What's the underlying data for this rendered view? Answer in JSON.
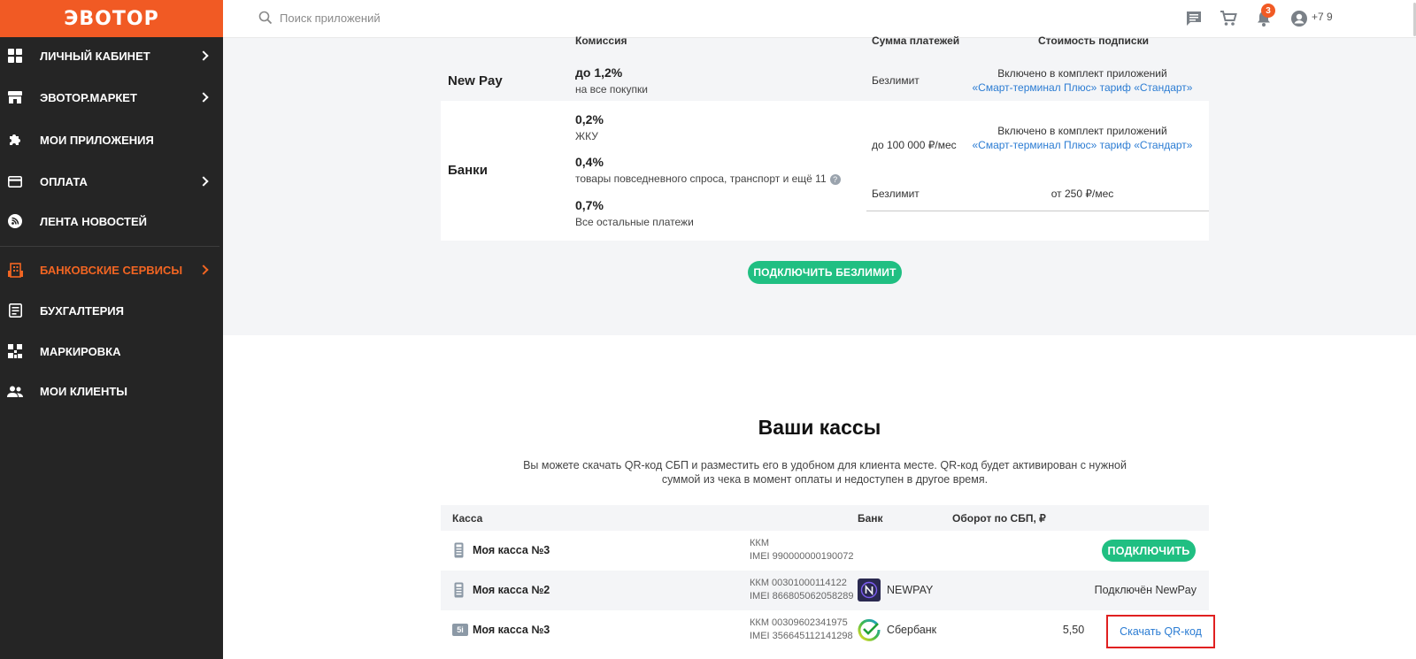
{
  "brand": {
    "logo_text": "ЭВОТОР",
    "accent_color": "#f15a24",
    "active_color": "#f26522",
    "button_color": "#20bf82",
    "link_color": "#2b7cd3"
  },
  "sidebar": {
    "items": [
      {
        "label": "ЛИЧНЫЙ КАБИНЕТ",
        "icon": "dashboard-icon",
        "has_chevron": true
      },
      {
        "label": "ЭВОТОР.МАРКЕТ",
        "icon": "store-icon",
        "has_chevron": true
      },
      {
        "label": "МОИ ПРИЛОЖЕНИЯ",
        "icon": "puzzle-icon",
        "has_chevron": false
      },
      {
        "label": "ОПЛАТА",
        "icon": "credit-card-icon",
        "has_chevron": true
      },
      {
        "label": "ЛЕНТА НОВОСТЕЙ",
        "icon": "rss-icon",
        "has_chevron": false
      },
      {
        "label": "БАНКОВСКИЕ СЕРВИСЫ",
        "icon": "bank-building-icon",
        "has_chevron": true,
        "active": true
      },
      {
        "label": "БУХГАЛТЕРИЯ",
        "icon": "ledger-icon",
        "has_chevron": false
      },
      {
        "label": "МАРКИРОВКА",
        "icon": "qr-mark-icon",
        "has_chevron": false
      },
      {
        "label": "МОИ КЛИЕНТЫ",
        "icon": "clients-icon",
        "has_chevron": false
      }
    ]
  },
  "topbar": {
    "search_placeholder": "Поиск приложений",
    "notification_count": "3",
    "phone": "+7 9"
  },
  "tariffs": {
    "headers": {
      "commission": "Комиссия",
      "payments_sum": "Сумма платежей",
      "subscription_cost": "Стоимость подписки"
    },
    "newpay": {
      "name": "New Pay",
      "rate": "до 1,2%",
      "rate_note": "на все покупки",
      "sum": "Безлимит",
      "cost_line1": "Включено в комплект приложений",
      "cost_line2": "«Смарт-терминал Плюс» тариф «Стандарт»"
    },
    "banks": {
      "name": "Банки",
      "rates": [
        {
          "value": "0,2%",
          "note": "ЖКУ"
        },
        {
          "value": "0,4%",
          "note": "товары повседневного спроса, транспорт и ещё 11"
        },
        {
          "value": "0,7%",
          "note": "Все остальные платежи"
        }
      ],
      "plan1_sum": "до 100 000 ₽/мес",
      "plan1_cost_line1": "Включено в комплект приложений",
      "plan1_cost_line2": "«Смарт-терминал Плюс» тариф «Стандарт»",
      "plan2_sum": "Безлимит",
      "plan2_cost": "от 250 ₽/мес"
    },
    "connect_button": "ПОДКЛЮЧИТЬ БЕЗЛИМИТ"
  },
  "kassas": {
    "title": "Ваши кассы",
    "description": "Вы можете скачать QR-код СБП и разместить его в удобном для клиента месте. QR-код будет активирован с нужной суммой из чека в момент оплаты и недоступен в другое время.",
    "columns": {
      "kassa": "Касса",
      "bank": "Банк",
      "turnover": "Оборот по СБП, ₽"
    },
    "rows": [
      {
        "name": "Моя касса №3",
        "kkm": "ККМ",
        "imei": "IMEI 990000000190072",
        "bank": "",
        "turnover": "",
        "action": "ПОДКЛЮЧИТЬ",
        "device": "phone-device-icon"
      },
      {
        "name": "Моя касса №2",
        "kkm": "ККМ 00301000114122",
        "imei": "IMEI 866805062058289",
        "bank": "NEWPAY",
        "turnover": "",
        "action": "Подключён NewPay",
        "device": "phone-device-icon"
      },
      {
        "name": "Моя касса №3",
        "kkm": "ККМ 00309602341975",
        "imei": "IMEI 356645112141298",
        "bank": "Сбербанк",
        "turnover": "5,50",
        "action": "Скачать QR-код",
        "device": "terminal-5i-icon",
        "device_label": "5i"
      }
    ]
  }
}
